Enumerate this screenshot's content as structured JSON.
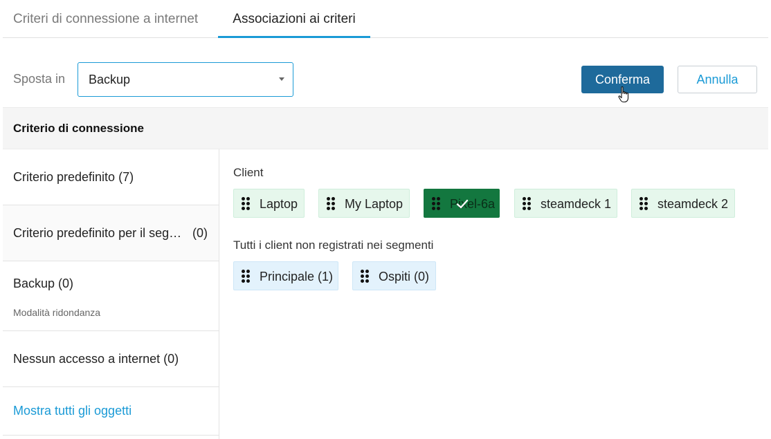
{
  "tabs": [
    {
      "label": "Criteri di connessione a internet"
    },
    {
      "label": "Associazioni ai criteri"
    }
  ],
  "toolbar": {
    "move_label": "Sposta in",
    "select_value": "Backup",
    "confirm_label": "Conferma",
    "cancel_label": "Annulla"
  },
  "section": {
    "title": "Criterio di connessione"
  },
  "sidebar": {
    "items": [
      {
        "label": "Criterio predefinito (7)"
      },
      {
        "label": "Criterio predefinito per il segmento",
        "count": "(0)"
      },
      {
        "label": "Backup (0)",
        "sub": "Modalità ridondanza"
      },
      {
        "label": "Nessun accesso a internet (0)"
      }
    ],
    "show_all": "Mostra tutti gli oggetti"
  },
  "groups": {
    "clients_label": "Client",
    "clients": [
      {
        "label": "Laptop"
      },
      {
        "label": "My Laptop"
      },
      {
        "label": "Pixel-6a",
        "selected": true
      },
      {
        "label": "steamdeck 1"
      },
      {
        "label": "steamdeck 2"
      }
    ],
    "segments_label": "Tutti i client non registrati nei segmenti",
    "segments": [
      {
        "label": "Principale (1)"
      },
      {
        "label": "Ospiti (0)"
      }
    ]
  },
  "colors": {
    "accent": "#1a9ad6",
    "primary_button": "#1e6a9b",
    "selected_chip": "#13773f",
    "client_chip": "#e6f7ec",
    "segment_chip": "#e3f2fc"
  },
  "icons": {
    "drag": "drag-handle-icon",
    "check": "checkmark-icon",
    "dropdown": "caret-down-icon",
    "cursor": "hand-pointer-icon"
  }
}
